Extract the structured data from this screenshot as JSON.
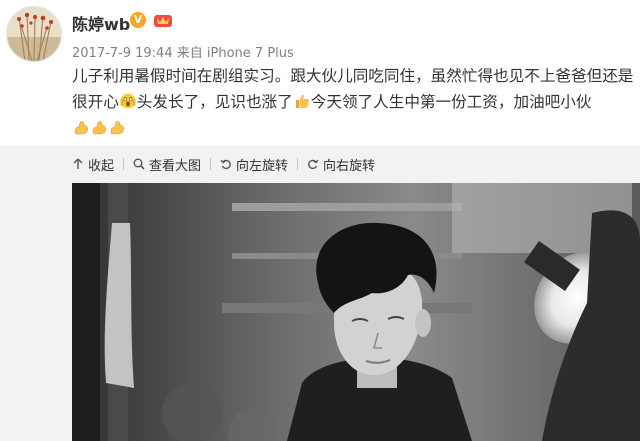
{
  "header": {
    "username": "陈婷wb",
    "vip_badge": "V",
    "post_time": "2017-7-9 19:44",
    "source_prefix": "来自",
    "source_device": "iPhone 7 Plus"
  },
  "post": {
    "text_part1": "儿子利用暑假时间在剧组实习。跟大伙儿同吃同住，虽然忙得也见不上爸爸但还是很开心",
    "text_part2": "头发长了，见识也涨了",
    "text_part3": "今天领了人生中第一份工资，加油吧小伙",
    "emojis": [
      "scream-emoji",
      "thumbs-up-emoji",
      "flexed-biceps-emoji"
    ]
  },
  "toolbar": {
    "collapse_label": "收起",
    "view_large_label": "查看大图",
    "rotate_left_label": "向左旋转",
    "rotate_right_label": "向右旋转"
  },
  "photo": {
    "description_icon": "black-and-white-photo",
    "style": "grayscale"
  },
  "colors": {
    "text": "#333333",
    "meta": "#808080",
    "media_background": "#f2f2f5",
    "vip_badge": "#f5a623"
  }
}
